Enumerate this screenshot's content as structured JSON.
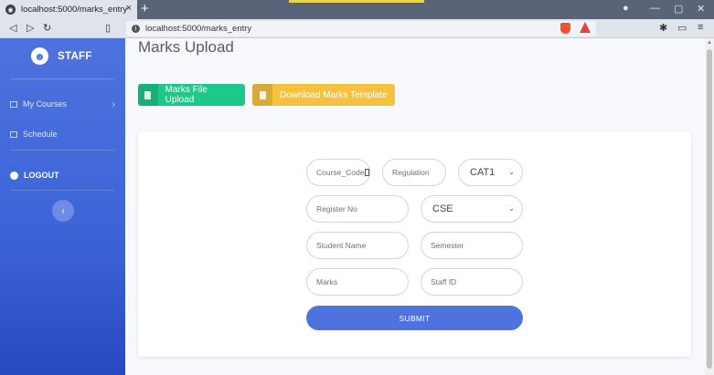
{
  "browser": {
    "tab_title": "localhost:5000/marks_entry",
    "tab_close": "×",
    "new_tab": "+",
    "url": "localhost:5000/marks_entry"
  },
  "sidebar": {
    "brand": "STAFF",
    "items": [
      {
        "label": "My Courses",
        "icon": "book-icon"
      },
      {
        "label": "Schedule",
        "icon": "calendar-icon"
      }
    ],
    "logout": "LOGOUT"
  },
  "main": {
    "title": "Marks Upload",
    "upload_button": "Marks File Upload",
    "download_button": "Download Marks Template"
  },
  "form": {
    "course_code_placeholder": "Course_Code",
    "regulation_placeholder": "Regulation",
    "exam_select": "CAT1",
    "register_no_placeholder": "Register No",
    "department_select": "CSE",
    "student_name_placeholder": "Student Name",
    "semester_placeholder": "Semester",
    "marks_placeholder": "Marks",
    "staff_id_placeholder": "Staff ID",
    "submit": "SUBMIT"
  },
  "colors": {
    "sidebar": "#4e73df",
    "green_button": "#1cc88a",
    "yellow_button": "#f6c23e",
    "submit": "#4e73df"
  }
}
